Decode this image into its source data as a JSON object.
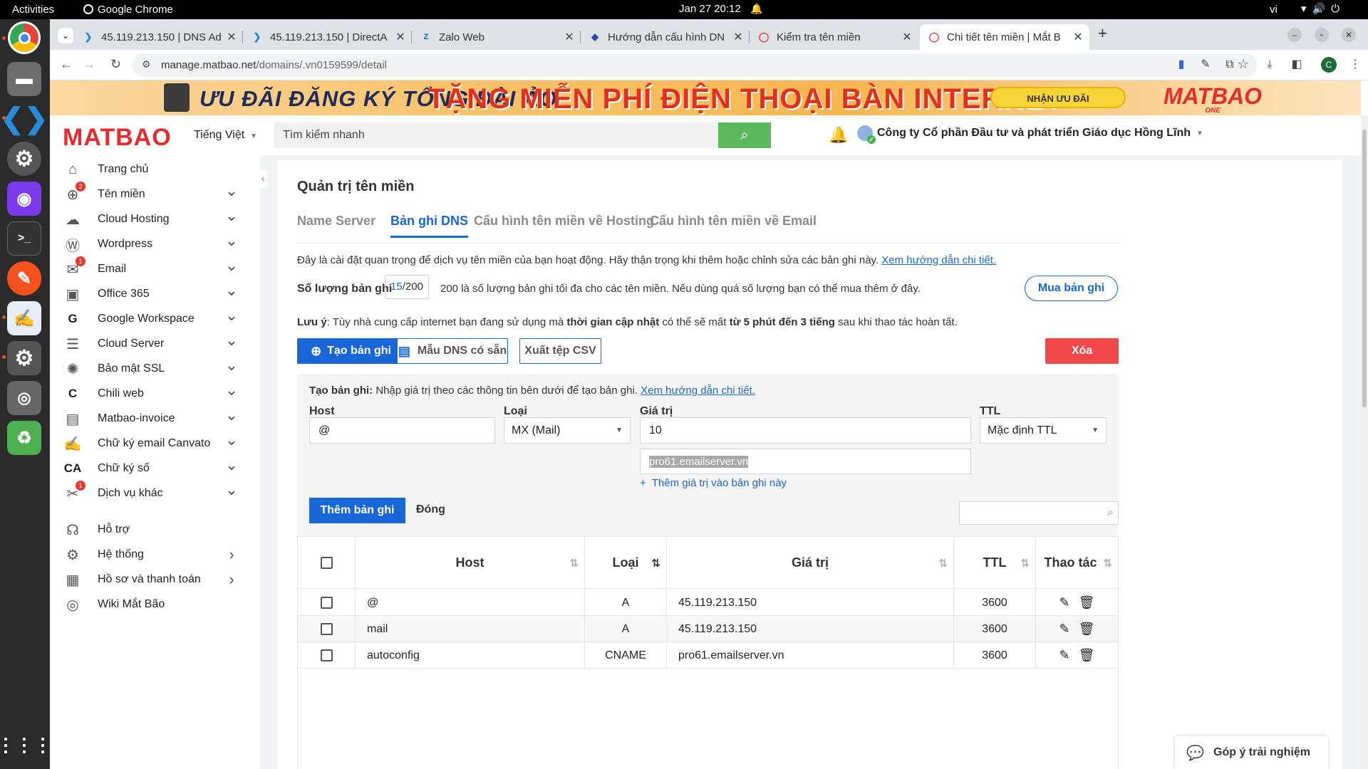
{
  "topbar": {
    "activities": "Activities",
    "app": "Google Chrome",
    "clock": "Jan 27  20:12",
    "lang": "vi"
  },
  "tabs": [
    {
      "title": "45.119.213.150 | DNS Ad",
      "icon": "directadmin-icon"
    },
    {
      "title": "45.119.213.150 | DirectA",
      "icon": "directadmin-icon"
    },
    {
      "title": "Zalo Web",
      "icon": "zalo-icon"
    },
    {
      "title": "Hướng dẫn cấu hình DN",
      "icon": "docs-icon"
    },
    {
      "title": "Kiểm tra tên miền",
      "icon": "chrome-icon"
    },
    {
      "title": "Chi tiết tên miền | Mắt B",
      "icon": "chrome-icon"
    }
  ],
  "address": {
    "host": "manage.matbao.net",
    "path": "/domains/.vn0159599/detail"
  },
  "banner": {
    "line1": "ƯU ĐÃI ĐĂNG KÝ TỔNG ĐÀI ẢO",
    "line2": "TẶNG MIỄN PHÍ  ĐIỆN THOẠI BÀN INTERNET",
    "cta": "NHẬN ƯU ĐÃI",
    "brand": "MATBAO",
    "brand_sub": "ONE"
  },
  "header": {
    "logo": "MATBAO",
    "language": "Tiếng Việt",
    "search_placeholder": "Tìm kiếm nhanh",
    "account": "Công ty Cổ phần Đầu tư và phát triển Giáo dục Hồng Lĩnh"
  },
  "sidebar": {
    "items": [
      {
        "label": "Trang chủ",
        "icon": "home-icon",
        "badge": "",
        "chevron": ""
      },
      {
        "label": "Tên miền",
        "icon": "globe-icon",
        "badge": "2",
        "chevron": "⌄"
      },
      {
        "label": "Cloud Hosting",
        "icon": "cloud-icon",
        "badge": "",
        "chevron": "⌄"
      },
      {
        "label": "Wordpress",
        "icon": "wordpress-icon",
        "badge": "",
        "chevron": "⌄"
      },
      {
        "label": "Email",
        "icon": "mail-icon",
        "badge": "1",
        "chevron": "⌄"
      },
      {
        "label": "Office 365",
        "icon": "office-icon",
        "badge": "",
        "chevron": "⌄"
      },
      {
        "label": "Google Workspace",
        "icon": "google-icon",
        "badge": "",
        "chevron": "⌄"
      },
      {
        "label": "Cloud Server",
        "icon": "server-icon",
        "badge": "",
        "chevron": "⌄"
      },
      {
        "label": "Bảo mật SSL",
        "icon": "ssl-icon",
        "badge": "",
        "chevron": "⌄"
      },
      {
        "label": "Chili web",
        "icon": "chili-icon",
        "badge": "",
        "chevron": "⌄"
      },
      {
        "label": "Matbao-invoice",
        "icon": "invoice-icon",
        "badge": "",
        "chevron": "⌄"
      },
      {
        "label": "Chữ ký email Canvato",
        "icon": "canvato-icon",
        "badge": "",
        "chevron": "⌄"
      },
      {
        "label": "Chữ ký số",
        "icon": "ca-icon",
        "badge": "",
        "chevron": "⌄"
      },
      {
        "label": "Dịch vụ khác",
        "icon": "tools-icon",
        "badge": "1",
        "chevron": "⌄"
      },
      {
        "label": "Hỗ trợ",
        "icon": "headset-icon",
        "badge": "",
        "chevron": ""
      },
      {
        "label": "Hệ thống",
        "icon": "gear-icon",
        "badge": "",
        "chevron": "›"
      },
      {
        "label": "Hồ sơ và thanh toán",
        "icon": "profile-icon",
        "badge": "",
        "chevron": "›"
      },
      {
        "label": "Wiki Mắt Bão",
        "icon": "wiki-icon",
        "badge": "",
        "chevron": ""
      }
    ]
  },
  "main": {
    "title": "Quản trị tên miền",
    "tabs": [
      "Name Server",
      "Bản ghi DNS",
      "Cấu hình tên miền về Hosting",
      "Cấu hình tên miền về Email"
    ],
    "intro": "Đây là cài đặt quan trọng để dịch vụ tên miền của bạn hoạt động. Hãy thận trọng khi thêm hoặc chỉnh sửa các bản ghi này.",
    "intro_link": "Xem hướng dẫn chi tiết.",
    "qty_label": "Số lượng bản ghi",
    "qty_used": "15",
    "qty_total": "/200",
    "qty_note": "200 là số lượng bản ghi tối đa cho các tên miền. Nếu dùng quá số lượng bạn có thể mua thêm ở đây.",
    "buy_btn": "Mua bản ghi",
    "note_prefix": "Lưu ý",
    "note_1": ": Tùy nhà cung cấp internet bạn đang sử dụng mà ",
    "note_b1": "thời gian cập nhật",
    "note_2": " có thể sẽ mất ",
    "note_b2": "từ 5 phút đến 3 tiếng",
    "note_3": " sau khi thao tác hoàn tất.",
    "create_btn": "Tạo bản ghi",
    "template_btn": "Mẫu DNS có sẵn",
    "csv_btn": "Xuất tệp CSV",
    "delete_btn": "Xóa"
  },
  "form": {
    "intro_b": "Tạo bản ghi:",
    "intro": " Nhập giá trị theo các thông tin bên dưới để tạo bản ghi. ",
    "intro_link": "Xem hướng dẫn chi tiết.",
    "host_label": "Host",
    "host_value": "@",
    "type_label": "Loại",
    "type_value": "MX (Mail)",
    "value_label": "Giá trị",
    "value_value": "10",
    "value2": "pro61.emailserver.vn",
    "ttl_label": "TTL",
    "ttl_value": "Mặc định TTL",
    "add_value": "Thêm giá trị vào bản ghi này",
    "add_btn": "Thêm bản ghi",
    "close_btn": "Đóng"
  },
  "table": {
    "headers": [
      "Host",
      "Loại",
      "Giá trị",
      "TTL",
      "Thao tác"
    ],
    "rows": [
      {
        "host": "@",
        "type": "A",
        "value": "45.119.213.150",
        "ttl": "3600"
      },
      {
        "host": "mail",
        "type": "A",
        "value": "45.119.213.150",
        "ttl": "3600"
      },
      {
        "host": "autoconfig",
        "type": "CNAME",
        "value": "pro61.emailserver.vn",
        "ttl": "3600"
      }
    ]
  },
  "feedback": "Góp ý trải nghiệm"
}
